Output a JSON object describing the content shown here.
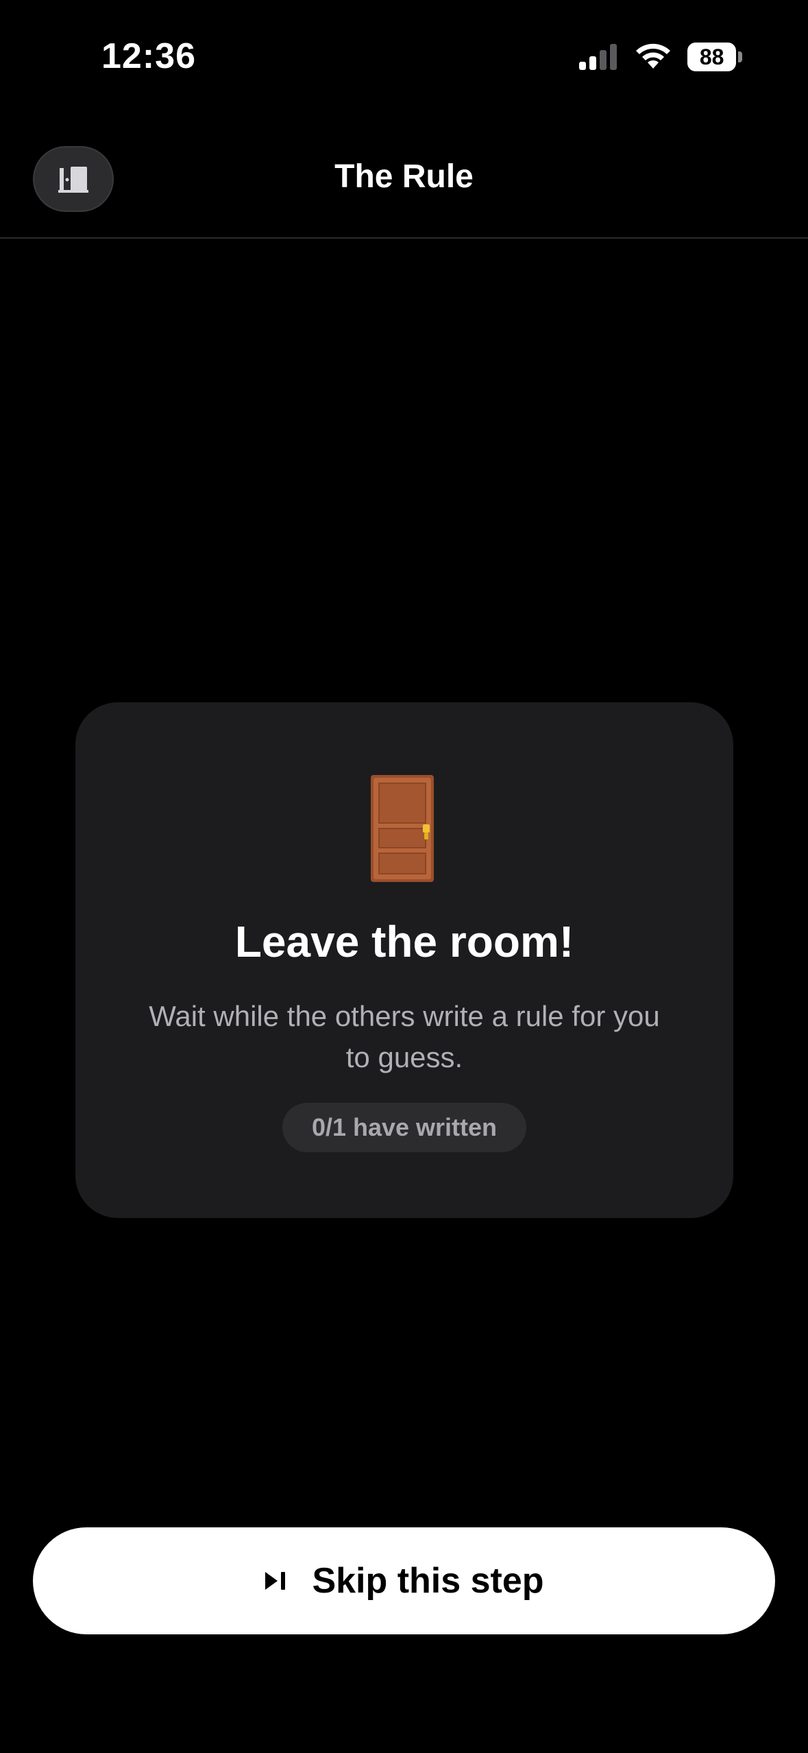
{
  "status_bar": {
    "time": "12:36",
    "battery_level": "88",
    "signal_icon": "cellular-signal-icon",
    "wifi_icon": "wifi-icon"
  },
  "header": {
    "title": "The Rule",
    "exit_icon": "door-exit-icon"
  },
  "card": {
    "icon": "door-emoji",
    "title": "Leave the room!",
    "message": "Wait while the others write a rule for you to guess.",
    "progress_text": "0/1 have written"
  },
  "footer": {
    "skip_icon": "skip-forward-icon",
    "skip_label": "Skip this step"
  },
  "colors": {
    "background": "#000000",
    "card": "#1c1c1e",
    "badge": "#2c2c2e",
    "button": "#ffffff"
  }
}
